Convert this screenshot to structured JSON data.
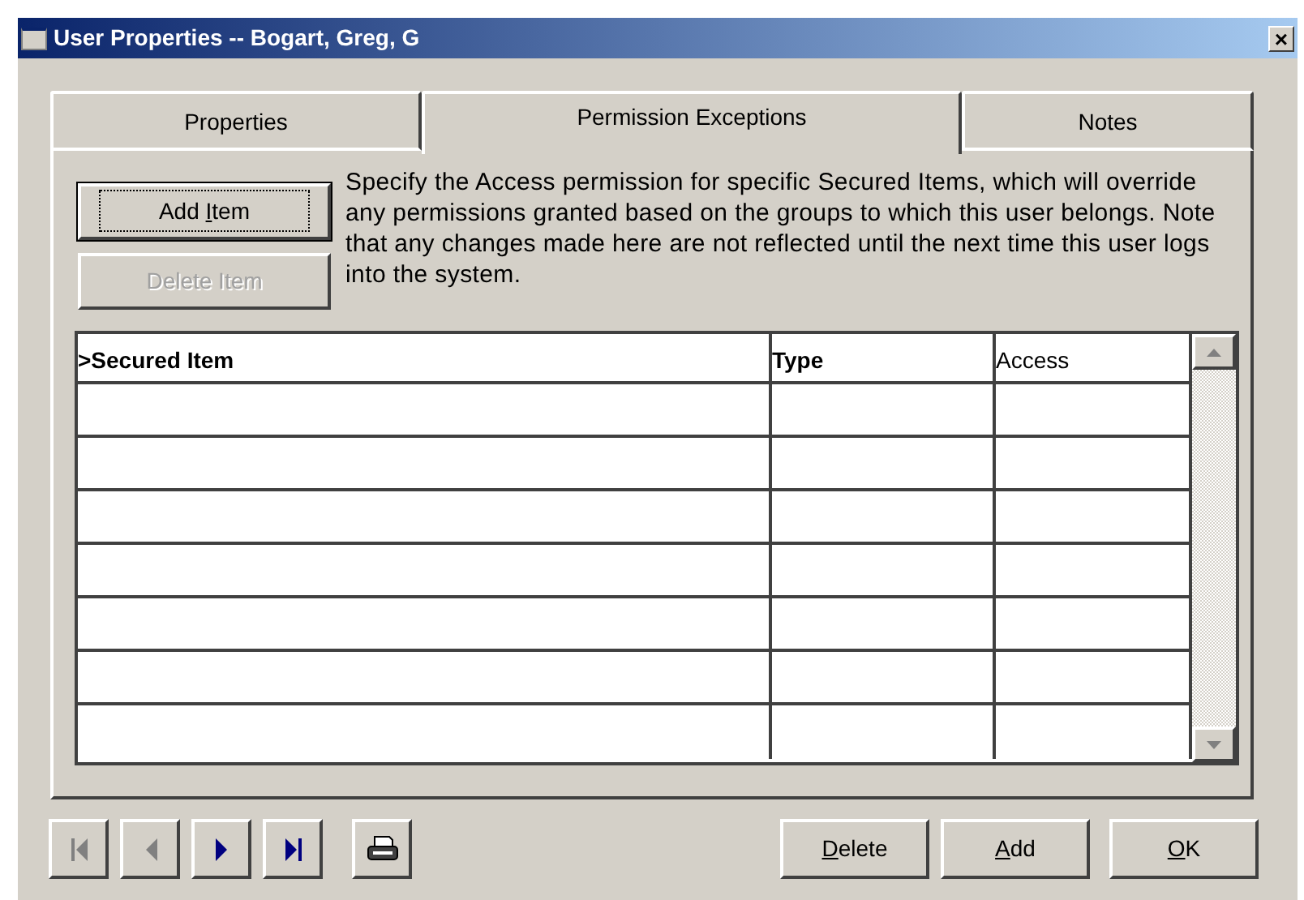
{
  "window": {
    "title": "User Properties -- Bogart, Greg, G",
    "close": "×"
  },
  "tabs": [
    {
      "label": "Properties",
      "selected": false
    },
    {
      "label": "Permission Exceptions",
      "selected": true
    },
    {
      "label": "Notes",
      "selected": false
    }
  ],
  "item_buttons": [
    {
      "before": "Add ",
      "key": "I",
      "after": "tem",
      "disabled": false,
      "focused": true
    },
    {
      "before": "Delete Item",
      "disabled": true,
      "focused": false
    }
  ],
  "description": "Specify the Access permission for specific Secured Items, which will override any permissions granted based on the groups to which this user belongs.  Note that any changes made here are not reflected until the next time this user logs into the system.",
  "table": {
    "columns": [
      {
        "label": ">Secured Item",
        "bold": true
      },
      {
        "label": "Type",
        "bold": true
      },
      {
        "label": "Access",
        "bold": false
      }
    ]
  },
  "nav_buttons": [
    {
      "kind": "first",
      "disabled": true
    },
    {
      "kind": "prev",
      "disabled": true
    },
    {
      "kind": "next",
      "disabled": false
    },
    {
      "kind": "last",
      "disabled": false
    }
  ],
  "action_buttons": [
    {
      "key": "D",
      "after": "elete"
    },
    {
      "key": "A",
      "after": "dd"
    },
    {
      "key": "O",
      "after": "K"
    }
  ]
}
